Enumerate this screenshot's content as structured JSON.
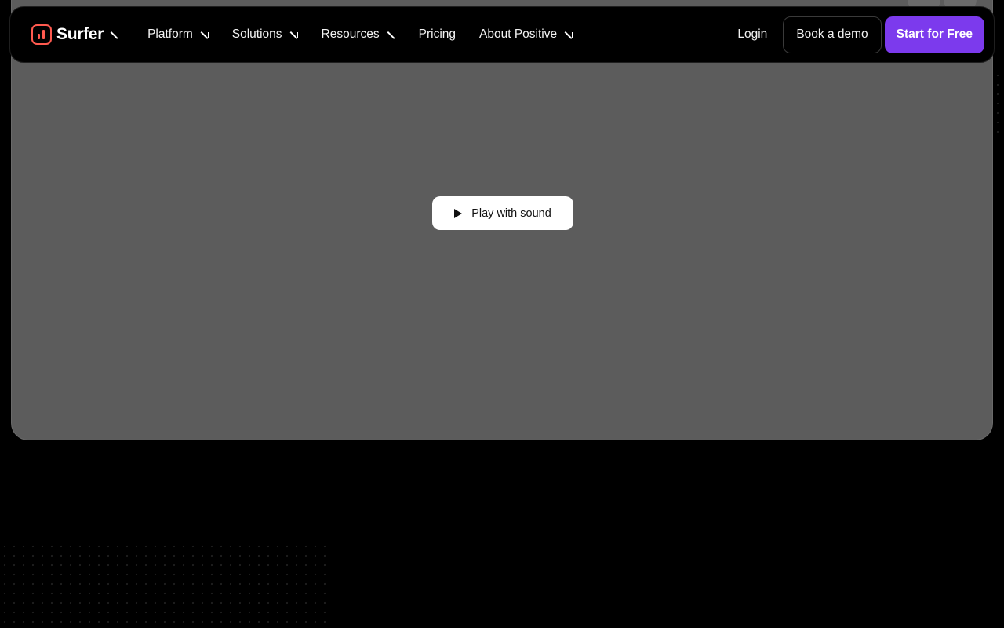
{
  "brand": {
    "name": "Surfer",
    "accent_color": "#ff5a4f",
    "logo_icon": "surfer-logo-icon"
  },
  "nav": {
    "items": [
      {
        "label": "Platform",
        "has_dropdown": true
      },
      {
        "label": "Solutions",
        "has_dropdown": true
      },
      {
        "label": "Resources",
        "has_dropdown": true
      },
      {
        "label": "Pricing",
        "has_dropdown": false
      },
      {
        "label": "About Positive",
        "has_dropdown": true
      }
    ],
    "dropdown_icon": "arrow-down-right-icon"
  },
  "actions": {
    "login_label": "Login",
    "demo_label": "Book a demo",
    "start_label": "Start for Free",
    "start_color": "#7c3aed"
  },
  "video": {
    "play_label": "Play with sound",
    "play_icon": "play-icon",
    "background_color": "#5c5c5c"
  }
}
